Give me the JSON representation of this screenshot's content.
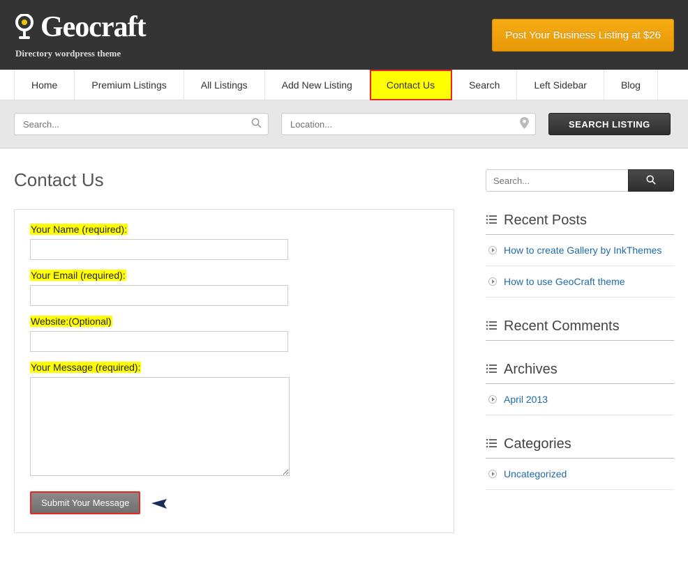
{
  "header": {
    "brand": "Geocraft",
    "tagline": "Directory wordpress theme",
    "cta": "Post Your Business Listing at $26"
  },
  "nav": {
    "items": [
      {
        "label": "Home"
      },
      {
        "label": "Premium Listings"
      },
      {
        "label": "All Listings"
      },
      {
        "label": "Add New Listing"
      },
      {
        "label": "Contact Us",
        "active": true
      },
      {
        "label": "Search"
      },
      {
        "label": "Left Sidebar"
      },
      {
        "label": "Blog"
      }
    ]
  },
  "searchbar": {
    "search_placeholder": "Search...",
    "location_placeholder": "Location...",
    "button": "SEARCH LISTING"
  },
  "page": {
    "title": "Contact Us"
  },
  "form": {
    "name_label": "Your Name (required)",
    "email_label": "Your Email (required)",
    "website_label": "Website:(Optional)",
    "message_label": "Your Message (required)",
    "submit": "Submit Your Message"
  },
  "sidebar": {
    "search_placeholder": "Search...",
    "widgets": {
      "recent_posts": {
        "title": "Recent Posts",
        "items": [
          "How to create Gallery by InkThemes",
          "How to use GeoCraft theme"
        ]
      },
      "recent_comments": {
        "title": "Recent Comments",
        "items": []
      },
      "archives": {
        "title": "Archives",
        "items": [
          "April 2013"
        ]
      },
      "categories": {
        "title": "Categories",
        "items": [
          "Uncategorized"
        ]
      }
    }
  }
}
